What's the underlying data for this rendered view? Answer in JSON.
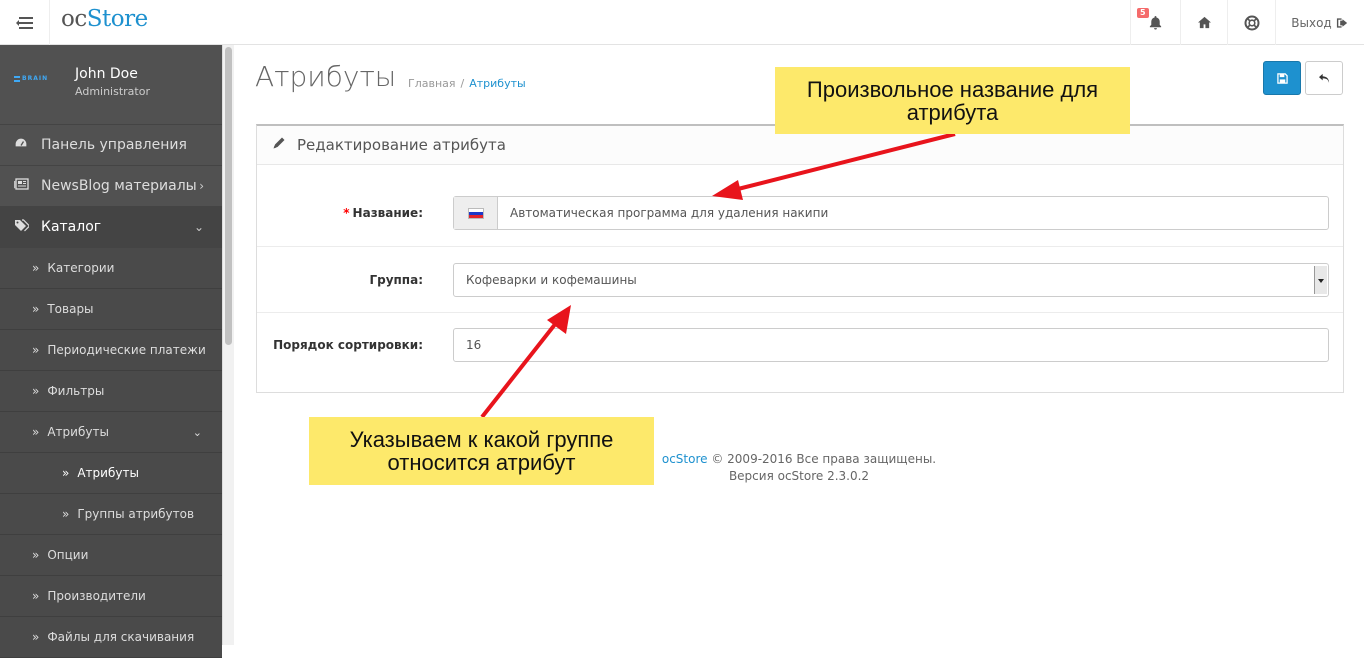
{
  "header": {
    "logo_oc": "oc",
    "logo_store": "Store",
    "notifications_count": "5",
    "logout_label": "Выход"
  },
  "sidebar": {
    "brand_text": "BRAIN",
    "user_name": "John Doe",
    "user_role": "Administrator",
    "items": [
      {
        "label": "Панель управления",
        "icon": "dashboard-icon"
      },
      {
        "label": "NewsBlog материалы",
        "icon": "newspaper-icon"
      },
      {
        "label": "Каталог",
        "icon": "tags-icon"
      }
    ],
    "catalog_sub": [
      {
        "label": "Категории"
      },
      {
        "label": "Товары"
      },
      {
        "label": "Периодические платежи"
      },
      {
        "label": "Фильтры"
      },
      {
        "label": "Атрибуты"
      }
    ],
    "attribute_sub": [
      {
        "label": "Атрибуты"
      },
      {
        "label": "Группы атрибутов"
      }
    ],
    "catalog_sub_more": [
      {
        "label": "Опции"
      },
      {
        "label": "Производители"
      },
      {
        "label": "Файлы для скачивания"
      }
    ]
  },
  "page": {
    "title": "Атрибуты",
    "breadcrumb_home": "Главная",
    "breadcrumb_current": "Атрибуты",
    "breadcrumb_sep": "/"
  },
  "panel": {
    "title": "Редактирование атрибута",
    "name_label": "Название:",
    "name_value": "Автоматическая программа для удаления накипи",
    "group_label": "Группа:",
    "group_value": "Кофеварки и кофемашины",
    "sort_label": "Порядок сортировки:",
    "sort_value": "16"
  },
  "footer": {
    "brand": "ocStore",
    "copyright": "© 2009-2016 Все права защищены.",
    "version": "Версия ocStore 2.3.0.2"
  },
  "annotations": {
    "note1": "Произвольное название для атрибута",
    "note2": "Указываем к какой группе относится атрибут"
  },
  "colors": {
    "accent": "#1e91cf",
    "sidebar_bg": "#515151",
    "note_bg": "#fde96b",
    "arrow": "#e8141c"
  }
}
